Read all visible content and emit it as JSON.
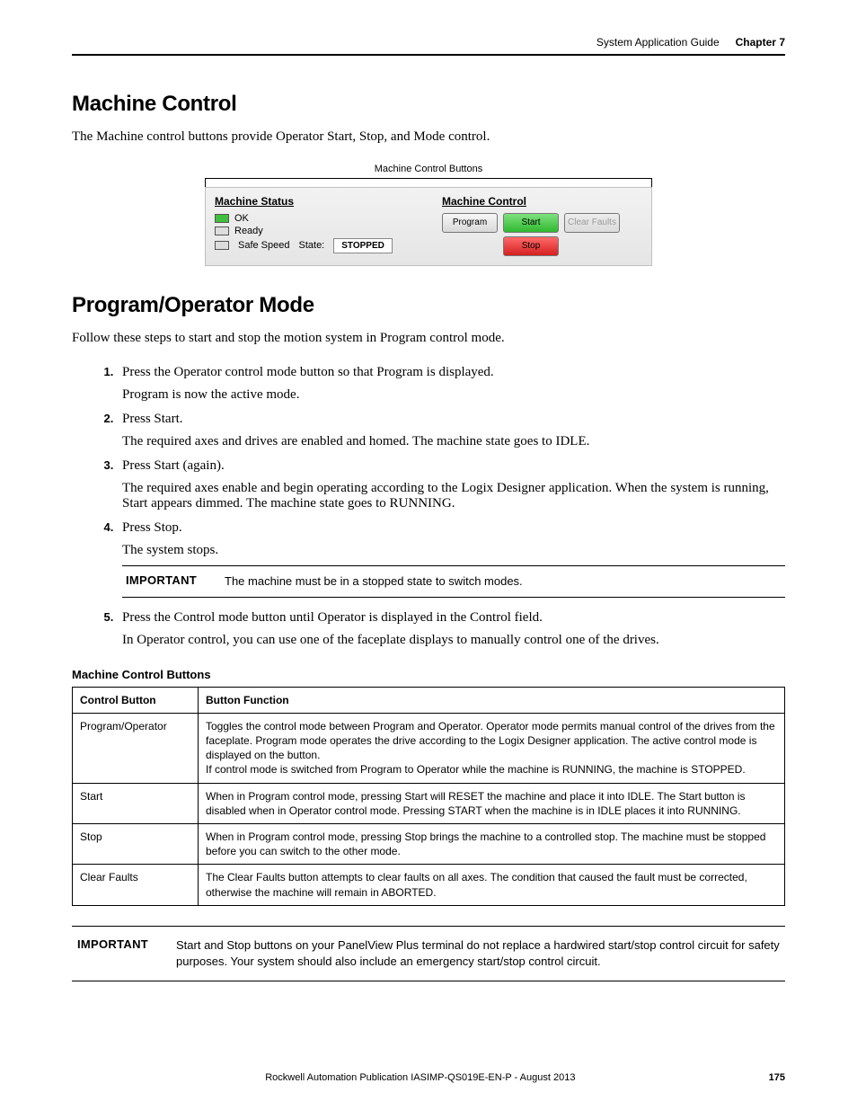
{
  "runningHead": {
    "title": "System Application Guide",
    "chapter": "Chapter 7"
  },
  "section1": {
    "heading": "Machine Control",
    "intro": "The Machine control buttons provide Operator Start, Stop, and Mode control.",
    "figureCaption": "Machine Control Buttons",
    "hmi": {
      "statusHeader": "Machine Status",
      "ok": "OK",
      "ready": "Ready",
      "safeSpeed": "Safe Speed",
      "stateLabel": "State:",
      "stateValue": "STOPPED",
      "controlHeader": "Machine Control",
      "btnProgram": "Program",
      "btnStart": "Start",
      "btnClearFaults": "Clear Faults",
      "btnStop": "Stop"
    }
  },
  "section2": {
    "heading": "Program/Operator Mode",
    "intro": "Follow these steps to start and stop the motion system in Program control mode.",
    "steps": [
      {
        "main": "Press the Operator control mode button so that Program is displayed.",
        "sub": "Program is now the active mode."
      },
      {
        "main": "Press Start.",
        "sub": "The required axes and drives are enabled and homed. The machine state goes to IDLE."
      },
      {
        "main": "Press Start (again).",
        "sub": "The required axes enable and begin operating according to the Logix Designer application. When the system is running, Start appears dimmed. The machine state goes to RUNNING."
      },
      {
        "main": "Press Stop.",
        "sub": "The system stops."
      }
    ],
    "important1": {
      "label": "IMPORTANT",
      "text": "The machine must be in a stopped state to switch modes."
    },
    "step5": {
      "main": "Press the Control mode button until Operator is displayed in the Control field.",
      "sub": "In Operator control, you can use one of the faceplate displays to manually control one of the drives."
    }
  },
  "table": {
    "caption": "Machine Control Buttons",
    "head": {
      "c1": "Control Button",
      "c2": "Button Function"
    },
    "rows": [
      {
        "c1": "Program/Operator",
        "c2": "Toggles the control mode between Program and Operator. Operator mode permits manual control of the drives from the faceplate. Program mode operates the drive according to the Logix Designer application. The active control mode is displayed on the button.\nIf control mode is switched from Program to Operator while the machine is RUNNING, the machine is STOPPED."
      },
      {
        "c1": "Start",
        "c2": "When in Program control mode, pressing Start will RESET the machine and place it into IDLE. The Start button is disabled when in Operator control mode. Pressing START when the machine is in IDLE places it into RUNNING."
      },
      {
        "c1": "Stop",
        "c2": "When in Program control mode, pressing Stop brings the machine to a controlled stop. The machine must be stopped before you can switch to the other mode."
      },
      {
        "c1": "Clear Faults",
        "c2": "The Clear Faults button attempts to clear faults on all axes. The condition that caused the fault must be corrected, otherwise the machine will remain in ABORTED."
      }
    ]
  },
  "important2": {
    "label": "IMPORTANT",
    "text": "Start and Stop buttons on your PanelView Plus terminal do not replace a hardwired start/stop control circuit for safety purposes. Your system should also include an emergency start/stop control circuit."
  },
  "footer": {
    "pub": "Rockwell Automation Publication IASIMP-QS019E-EN-P - August 2013",
    "page": "175"
  }
}
